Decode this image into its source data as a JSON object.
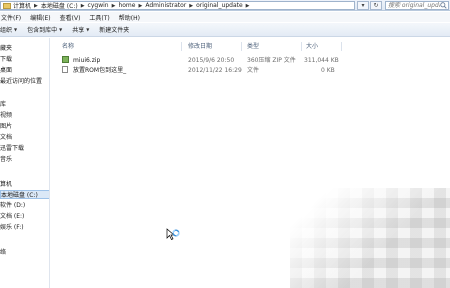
{
  "address": {
    "crumbs": [
      "计算机",
      "本地磁盘 (C:)",
      "cygwin",
      "home",
      "Administrator",
      "original_update"
    ],
    "search_placeholder": "搜索 original_update"
  },
  "menu": [
    "文件(F)",
    "编辑(E)",
    "查看(V)",
    "工具(T)",
    "帮助(H)"
  ],
  "toolbar": [
    "组织",
    "包含到库中",
    "共享",
    "新建文件夹"
  ],
  "sidebar": {
    "items": [
      "藏夹",
      "下载",
      "桌面",
      "最近访问的位置",
      "库",
      "视频",
      "图片",
      "文档",
      "迅雷下载",
      "音乐",
      "算机",
      "本地磁盘 (C:)",
      "软件 (D:)",
      "文档 (E:)",
      "娱乐 (F:)",
      "络"
    ]
  },
  "filelist": {
    "columns": [
      "名称",
      "修改日期",
      "类型",
      "大小"
    ],
    "rows": [
      {
        "name": "miui6.zip",
        "date": "2015/9/6 20:50",
        "type": "360压缩 ZIP 文件",
        "size": "311,044 KB"
      },
      {
        "name": "放置ROM包到这里_",
        "date": "2012/11/22 16:29",
        "type": "文件",
        "size": "0 KB"
      }
    ]
  }
}
